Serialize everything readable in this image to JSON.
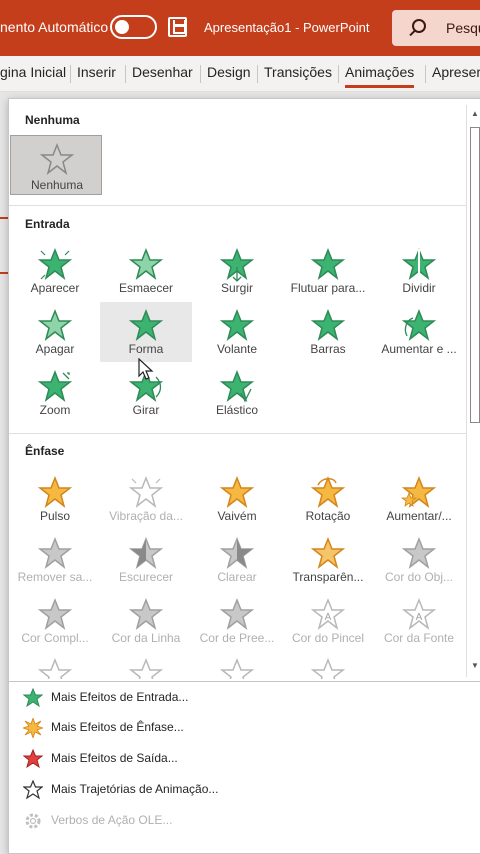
{
  "titlebar": {
    "autosave_label": "nento Automático",
    "document_title": "Apresentação1  -  PowerPoint",
    "search_text": "Pesqu"
  },
  "ribbon": {
    "tabs": [
      {
        "label": "gina Inicial"
      },
      {
        "label": "Inserir"
      },
      {
        "label": "Desenhar"
      },
      {
        "label": "Design"
      },
      {
        "label": "Transições"
      },
      {
        "label": "Animações"
      },
      {
        "label": "Apreser"
      }
    ],
    "active_tab": "Animações"
  },
  "gallery": {
    "none_section": {
      "header": "Nenhuma",
      "items": [
        {
          "label": "Nenhuma",
          "icon": "star-outline-icon"
        }
      ]
    },
    "entrance_section": {
      "header": "Entrada",
      "items": [
        {
          "label": "Aparecer",
          "icon": "star-appear-icon"
        },
        {
          "label": "Esmaecer",
          "icon": "star-fade-icon"
        },
        {
          "label": "Surgir",
          "icon": "star-fly-in-icon"
        },
        {
          "label": "Flutuar para...",
          "icon": "star-float-icon"
        },
        {
          "label": "Dividir",
          "icon": "star-split-icon"
        },
        {
          "label": "Apagar",
          "icon": "star-wipe-icon"
        },
        {
          "label": "Forma",
          "icon": "star-shape-icon"
        },
        {
          "label": "Volante",
          "icon": "star-wheel-icon"
        },
        {
          "label": "Barras",
          "icon": "star-bars-icon"
        },
        {
          "label": "Aumentar e ...",
          "icon": "star-grow-turn-icon"
        },
        {
          "label": "Zoom",
          "icon": "star-zoom-icon"
        },
        {
          "label": "Girar",
          "icon": "star-swivel-icon"
        },
        {
          "label": "Elástico",
          "icon": "star-bounce-icon"
        }
      ]
    },
    "emphasis_section": {
      "header": "Ênfase",
      "items": [
        {
          "label": "Pulso",
          "icon": "star-pulse-icon",
          "disabled": false
        },
        {
          "label": "Vibração da...",
          "icon": "star-color-pulse-icon",
          "disabled": true
        },
        {
          "label": "Vaivém",
          "icon": "star-teeter-icon",
          "disabled": false
        },
        {
          "label": "Rotação",
          "icon": "star-spin-icon",
          "disabled": false
        },
        {
          "label": "Aumentar/...",
          "icon": "star-grow-shrink-icon",
          "disabled": false
        },
        {
          "label": "Remover sa...",
          "icon": "star-desaturate-icon",
          "disabled": true
        },
        {
          "label": "Escurecer",
          "icon": "star-darken-icon",
          "disabled": true
        },
        {
          "label": "Clarear",
          "icon": "star-lighten-icon",
          "disabled": true
        },
        {
          "label": "Transparên...",
          "icon": "star-transparency-icon",
          "disabled": false
        },
        {
          "label": "Cor do Obj...",
          "icon": "star-object-color-icon",
          "disabled": true
        },
        {
          "label": "Cor Compl...",
          "icon": "star-complementary-color-icon",
          "disabled": true
        },
        {
          "label": "Cor da Linha",
          "icon": "star-line-color-icon",
          "disabled": true
        },
        {
          "label": "Cor de Pree...",
          "icon": "star-fill-color-icon",
          "disabled": true
        },
        {
          "label": "Cor do Pincel",
          "icon": "star-brush-color-icon",
          "disabled": true
        },
        {
          "label": "Cor da Fonte",
          "icon": "star-font-color-icon",
          "disabled": true
        }
      ]
    }
  },
  "menu": {
    "items": [
      {
        "label": "Mais Efeitos de Entrada...",
        "icon": "green-star-icon",
        "disabled": false
      },
      {
        "label": "Mais Efeitos de Ênfase...",
        "icon": "yellow-burst-star-icon",
        "disabled": false
      },
      {
        "label": "Mais Efeitos de Saída...",
        "icon": "red-star-icon",
        "disabled": false
      },
      {
        "label": "Mais Trajetórias de Animação...",
        "icon": "outline-star-icon",
        "disabled": false
      },
      {
        "label": "Verbos de Ação OLE...",
        "icon": "gear-icon",
        "disabled": true
      }
    ]
  },
  "colors": {
    "accent": "#c43e1c",
    "entrance_green": "#3cb371",
    "emphasis_yellow": "#f5b942",
    "exit_red": "#e04040",
    "disabled_gray": "#b0b0b0"
  }
}
